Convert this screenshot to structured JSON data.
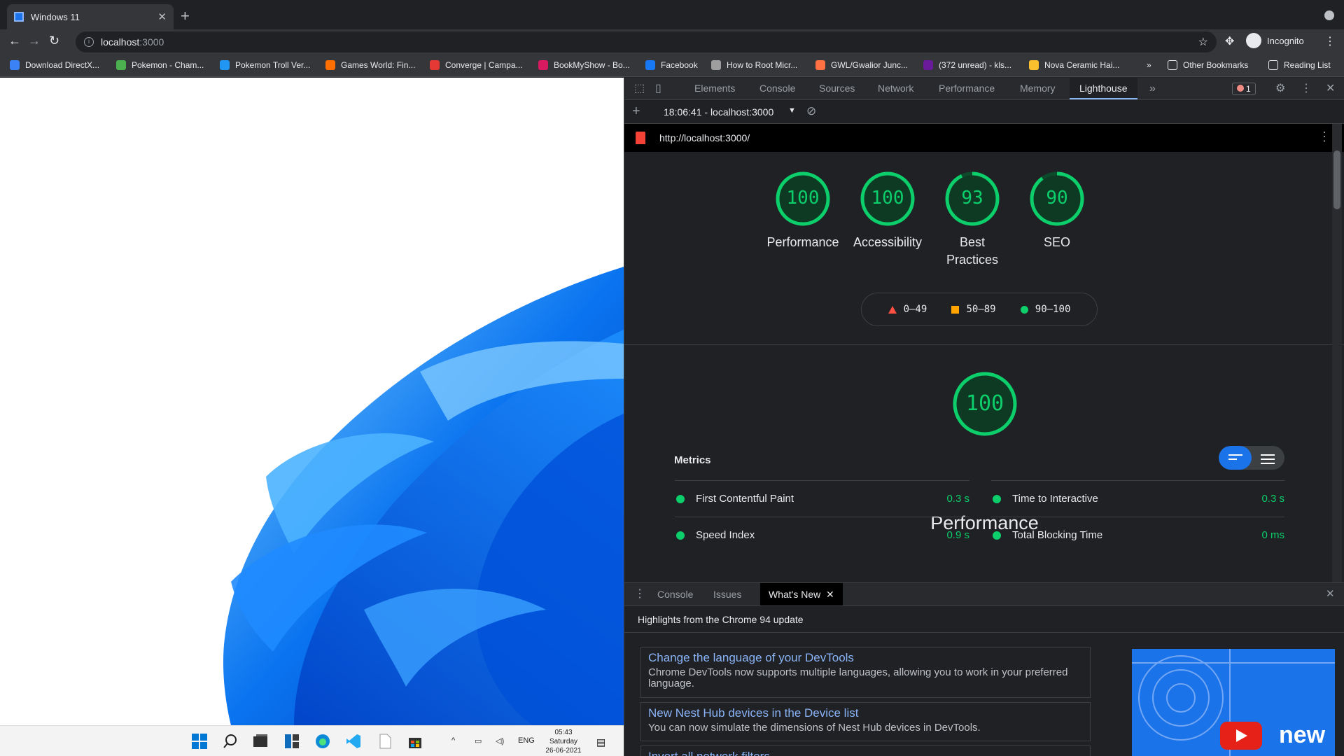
{
  "browser": {
    "tab_title": "Windows 11",
    "url_host": "localhost",
    "url_port": ":3000",
    "profile_label": "Incognito"
  },
  "bookmarks": [
    {
      "label": "Download DirectX...",
      "color": "#3b82f6"
    },
    {
      "label": "Pokemon - Cham...",
      "color": "#4caf50"
    },
    {
      "label": "Pokemon Troll Ver...",
      "color": "#2196f3"
    },
    {
      "label": "Games World: Fin...",
      "color": "#ff6f00"
    },
    {
      "label": "Converge | Campa...",
      "color": "#e53935"
    },
    {
      "label": "BookMyShow - Bo...",
      "color": "#d81b60"
    },
    {
      "label": "Facebook",
      "color": "#1877f2"
    },
    {
      "label": "How to Root Micr...",
      "color": "#9e9e9e"
    },
    {
      "label": "GWL/Gwalior Junc...",
      "color": "#ff7043"
    },
    {
      "label": "(372 unread) - kls...",
      "color": "#6a1b9a"
    },
    {
      "label": "Nova Ceramic Hai...",
      "color": "#fbc02d"
    }
  ],
  "bookmarks_overflow": "»",
  "other_bookmarks": "Other Bookmarks",
  "reading_list": "Reading List",
  "taskbar": {
    "time": "05:43",
    "day": "Saturday",
    "date": "26-06-2021",
    "lang": "ENG"
  },
  "devtools": {
    "tabs": [
      "Elements",
      "Console",
      "Sources",
      "Network",
      "Performance",
      "Memory",
      "Lighthouse"
    ],
    "more": "»",
    "error_count": "1",
    "report_select": "18:06:41 - localhost:3000",
    "report_url": "http://localhost:3000/",
    "scores": [
      {
        "value": 100,
        "label": "Performance"
      },
      {
        "value": 100,
        "label": "Accessibility"
      },
      {
        "value": 93,
        "label": "Best Practices"
      },
      {
        "value": 90,
        "label": "SEO"
      }
    ],
    "legend": {
      "fail": "0–49",
      "average": "50–89",
      "pass": "90–100"
    },
    "perf_score": 100,
    "perf_title": "Performance",
    "metrics_title": "Metrics",
    "metrics": [
      {
        "name": "First Contentful Paint",
        "value": "0.3 s"
      },
      {
        "name": "Time to Interactive",
        "value": "0.3 s"
      },
      {
        "name": "Speed Index",
        "value": "0.9 s"
      },
      {
        "name": "Total Blocking Time",
        "value": "0 ms"
      }
    ],
    "drawer": {
      "tabs": [
        "Console",
        "Issues",
        "What's New"
      ],
      "highlights": "Highlights from the Chrome 94 update",
      "items": [
        {
          "title": "Change the language of your DevTools",
          "desc": "Chrome DevTools now supports multiple languages, allowing you to work in your preferred language."
        },
        {
          "title": "New Nest Hub devices in the Device list",
          "desc": "You can now simulate the dimensions of Nest Hub devices in DevTools."
        },
        {
          "title": "Invert all network filters",
          "desc": ""
        }
      ],
      "thumb_text": "new"
    }
  },
  "colors": {
    "pass": "#0cce6b",
    "average": "#ffa400",
    "fail": "#ff4e42",
    "accent": "#1a73e8"
  }
}
